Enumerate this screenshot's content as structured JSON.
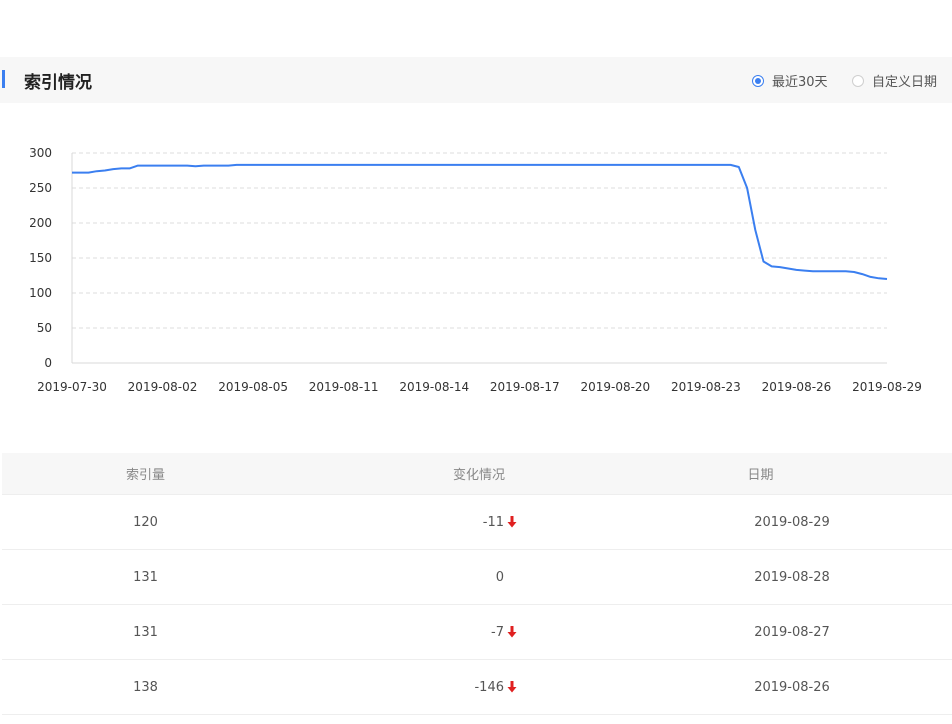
{
  "section": {
    "title": "索引情况",
    "range_options": [
      {
        "label": "最近30天",
        "checked": true
      },
      {
        "label": "自定义日期",
        "checked": false
      }
    ]
  },
  "colors": {
    "accent": "#3b7ff0",
    "line": "#3b7ff0",
    "down": "#e02020"
  },
  "chart_data": {
    "type": "line",
    "title": "",
    "xlabel": "",
    "ylabel": "",
    "ylim": [
      0,
      300
    ],
    "yticks": [
      "0",
      "50",
      "100",
      "150",
      "200",
      "250",
      "300"
    ],
    "xtick_labels": [
      "2019-07-30",
      "2019-08-02",
      "2019-08-05",
      "2019-08-11",
      "2019-08-14",
      "2019-08-17",
      "2019-08-20",
      "2019-08-23",
      "2019-08-26",
      "2019-08-29"
    ],
    "grid": true,
    "series": [
      {
        "values": [
          272,
          272,
          272,
          274,
          275,
          277,
          278,
          278,
          282,
          282,
          282,
          282,
          282,
          282,
          282,
          281,
          282,
          282,
          282,
          282,
          283,
          283,
          283,
          283,
          283,
          283,
          283,
          283,
          283,
          283,
          283,
          283,
          283,
          283,
          283,
          283,
          283,
          283,
          283,
          283,
          283,
          283,
          283,
          283,
          283,
          283,
          283,
          283,
          283,
          283,
          283,
          283,
          283,
          283,
          283,
          283,
          283,
          283,
          283,
          283,
          283,
          283,
          283,
          283,
          283,
          283,
          283,
          283,
          283,
          283,
          283,
          283,
          283,
          283,
          283,
          283,
          283,
          283,
          283,
          283,
          283,
          280,
          250,
          190,
          145,
          138,
          137,
          135,
          133,
          132,
          131,
          131,
          131,
          131,
          131,
          130,
          127,
          123,
          121,
          120
        ]
      }
    ]
  },
  "table": {
    "headers": [
      "索引量",
      "变化情况",
      "日期"
    ],
    "rows": [
      {
        "count": "120",
        "change": "-11",
        "down": true,
        "date": "2019-08-29"
      },
      {
        "count": "131",
        "change": "0",
        "down": false,
        "date": "2019-08-28"
      },
      {
        "count": "131",
        "change": "-7",
        "down": true,
        "date": "2019-08-27"
      },
      {
        "count": "138",
        "change": "-146",
        "down": true,
        "date": "2019-08-26"
      }
    ]
  }
}
